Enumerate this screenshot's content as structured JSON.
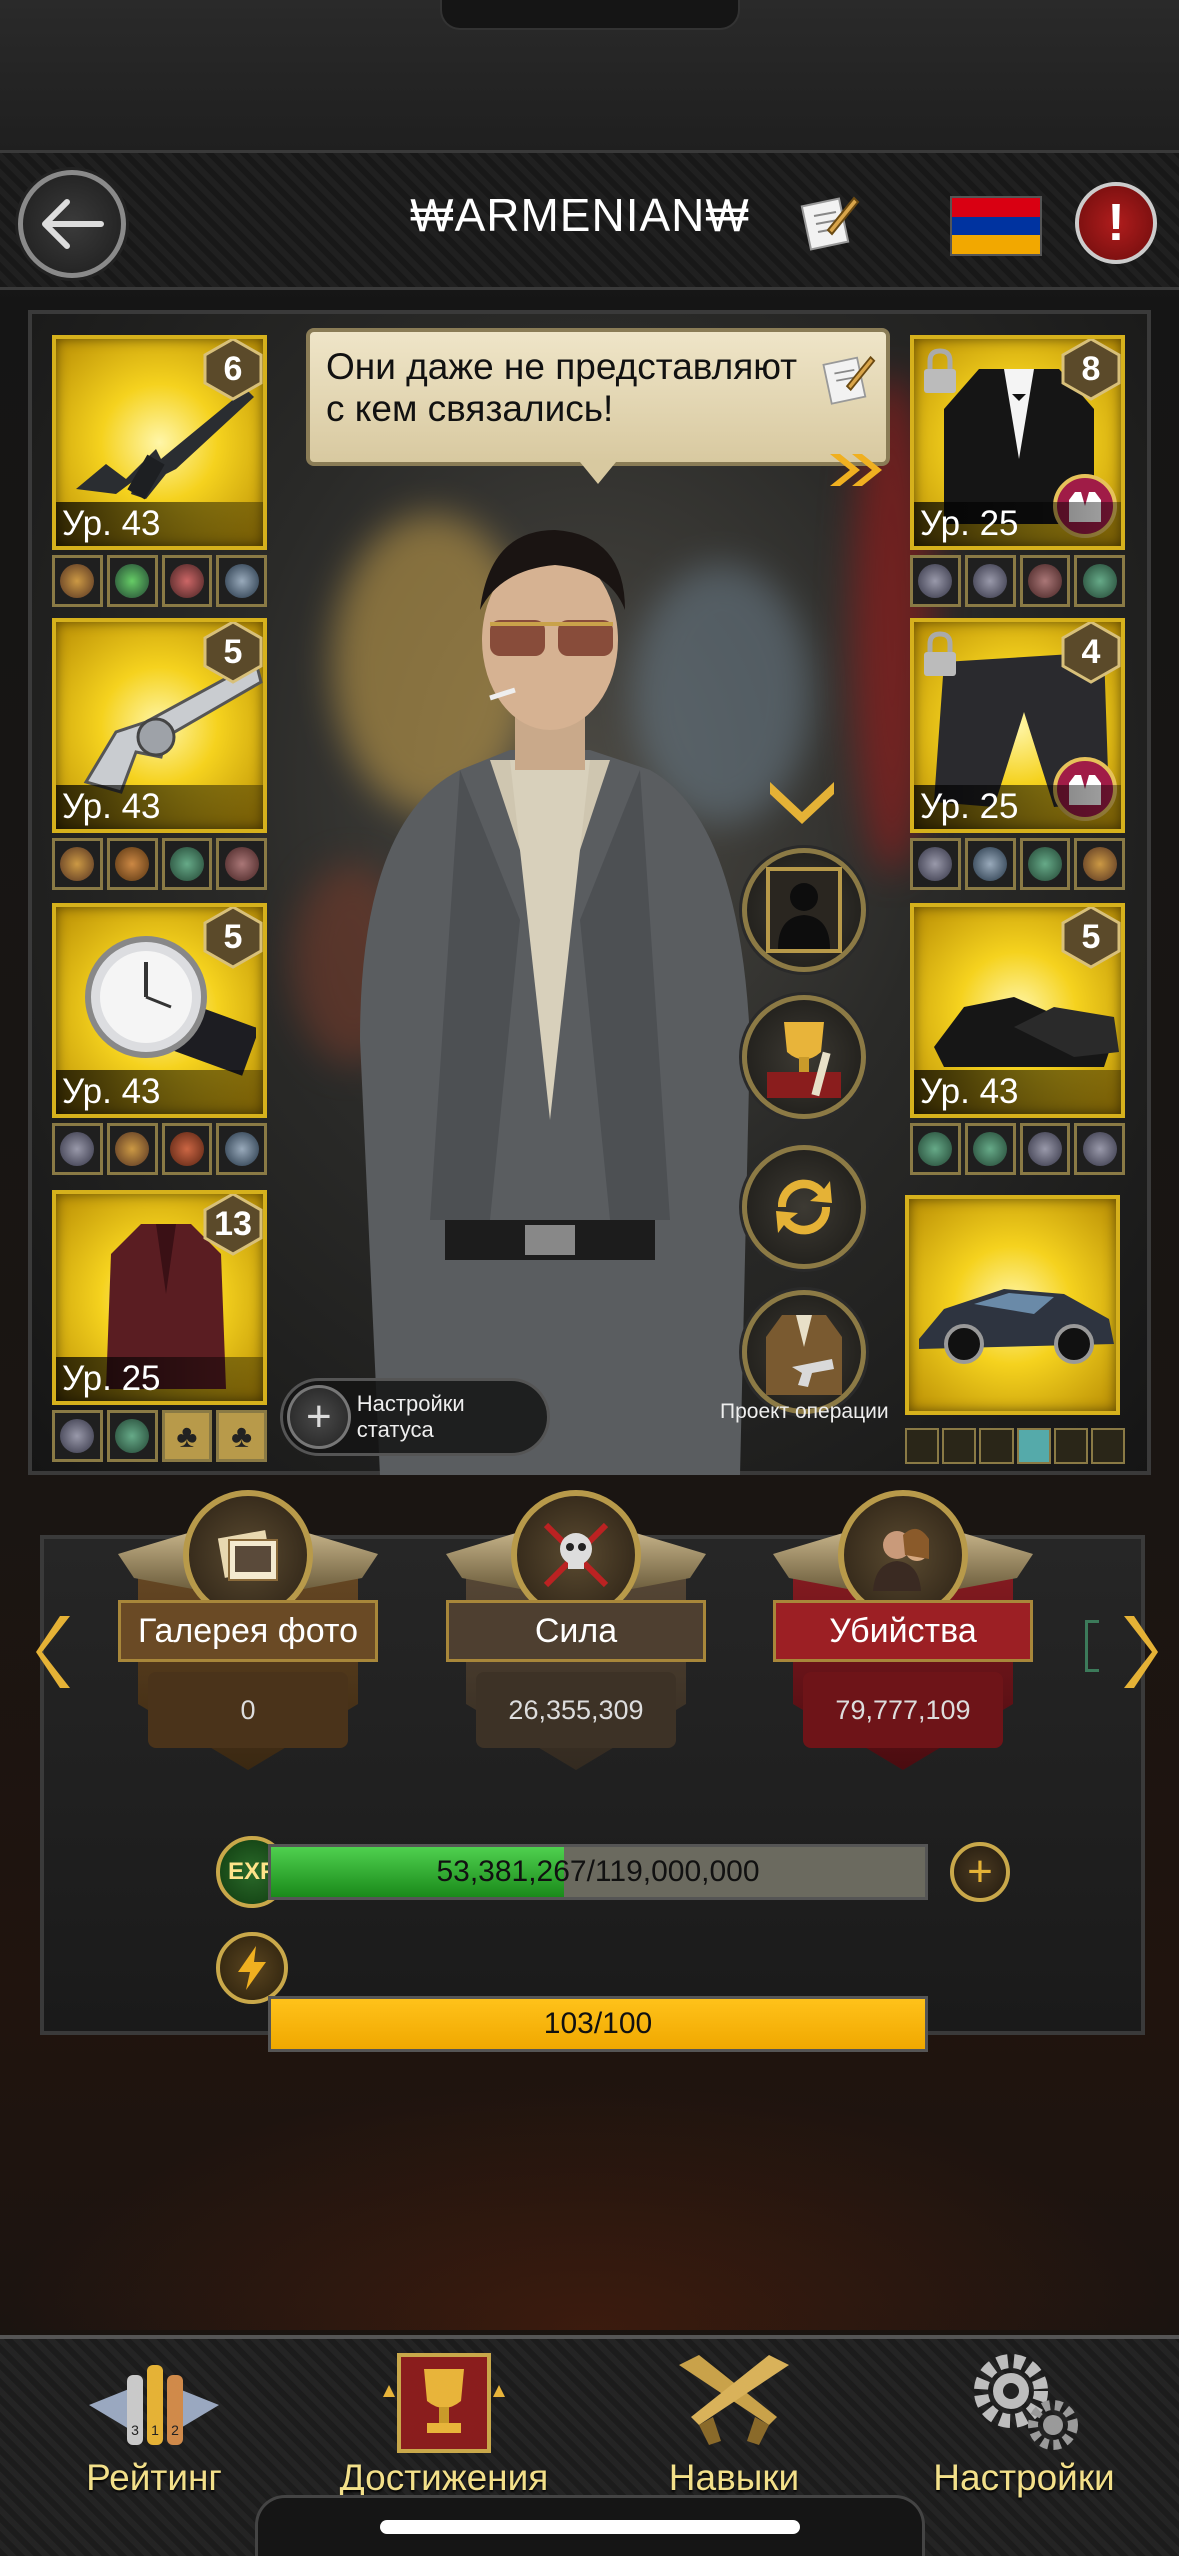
{
  "header": {
    "player_name": "₩ARMENIAN₩",
    "flag_colors": [
      "#D90012",
      "#0033A0",
      "#F2A800"
    ]
  },
  "speech_bubble": {
    "text": "Они даже не представляют с кем связались!"
  },
  "left_slots": [
    {
      "item": "assault-rifle",
      "level": "Ур. 43",
      "stars": "6"
    },
    {
      "item": "revolver",
      "level": "Ур. 43",
      "stars": "5"
    },
    {
      "item": "wristwatch",
      "level": "Ур. 43",
      "stars": "5"
    },
    {
      "item": "red-coat",
      "level": "Ур. 25",
      "stars": "13"
    }
  ],
  "right_slots": [
    {
      "item": "tuxedo-jacket",
      "level": "Ур. 25",
      "stars": "8"
    },
    {
      "item": "trousers",
      "level": "Ур. 25",
      "stars": "4"
    },
    {
      "item": "dress-shoes",
      "level": "Ур. 43",
      "stars": "5"
    }
  ],
  "side_buttons": {
    "status_settings": "Настройки статуса",
    "operation_project": "Проект операции"
  },
  "stats": [
    {
      "title": "Галерея фото",
      "value": "0",
      "accent": "#7a5a2a"
    },
    {
      "title": "Сила",
      "value": "26,355,309",
      "accent": "#5a4a38"
    },
    {
      "title": "Убийства",
      "value": "79,777,109",
      "accent": "#9c1f24"
    }
  ],
  "exp_bar": {
    "icon_label": "EXP",
    "text": "53,381,267/119,000,000",
    "fraction": 0.4486
  },
  "energy_bar": {
    "text": "103/100",
    "fraction": 1.0
  },
  "bottom_nav": [
    {
      "label": "Рейтинг",
      "icon": "ranking-bullets-icon"
    },
    {
      "label": "Достижения",
      "icon": "achievements-trophy-icon"
    },
    {
      "label": "Навыки",
      "icon": "skills-crossed-pistols-icon"
    },
    {
      "label": "Настройки",
      "icon": "settings-gears-icon"
    }
  ]
}
